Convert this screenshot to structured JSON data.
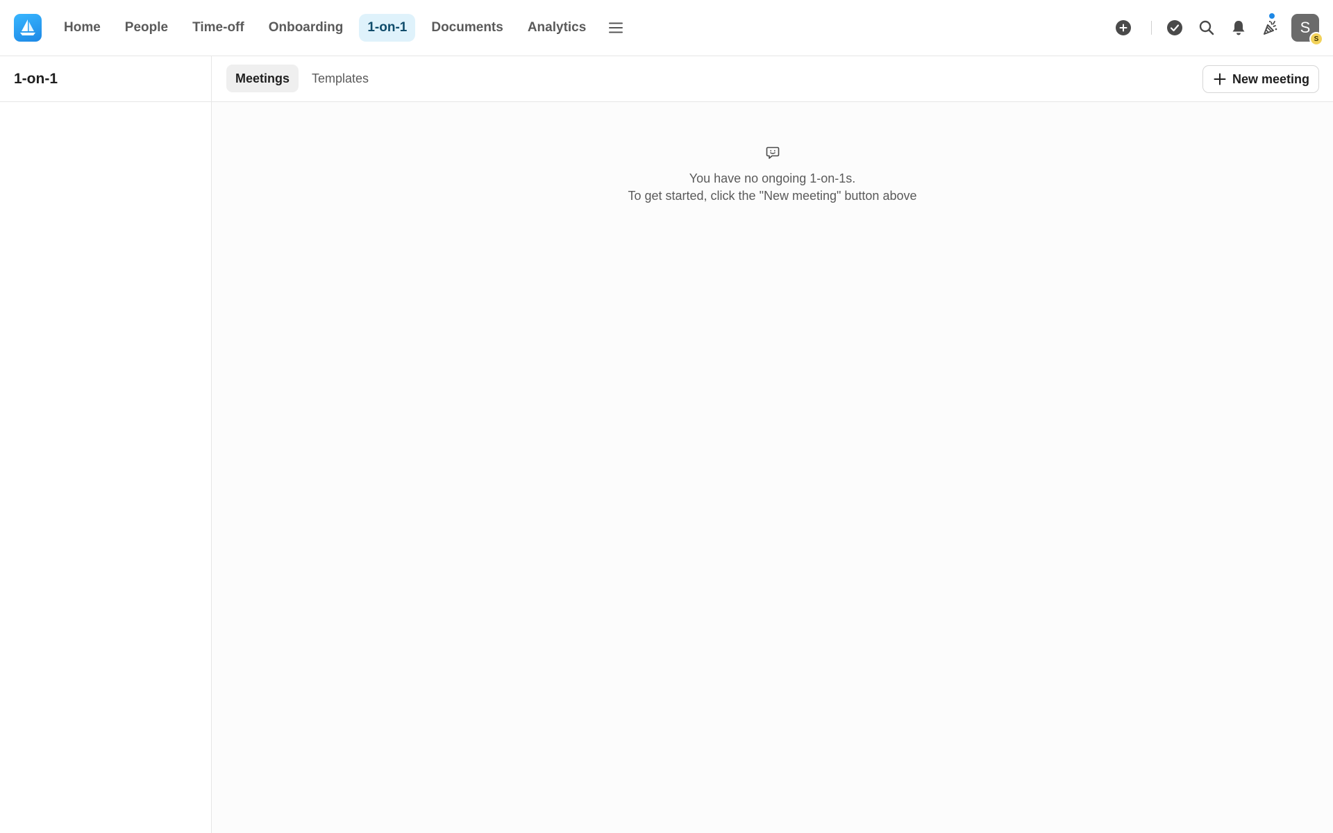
{
  "nav": {
    "items": [
      {
        "label": "Home",
        "active": false
      },
      {
        "label": "People",
        "active": false
      },
      {
        "label": "Time-off",
        "active": false
      },
      {
        "label": "Onboarding",
        "active": false
      },
      {
        "label": "1-on-1",
        "active": true
      },
      {
        "label": "Documents",
        "active": false
      },
      {
        "label": "Analytics",
        "active": false
      }
    ],
    "menu_icon": "hamburger-menu-icon"
  },
  "header_actions": {
    "icons": [
      "add-circle-icon",
      "check-circle-icon",
      "search-icon",
      "bell-icon",
      "party-popper-icon"
    ],
    "avatar_initial": "S",
    "avatar_badge": "S"
  },
  "sidebar": {
    "title": "1-on-1"
  },
  "subbar": {
    "tabs": [
      {
        "label": "Meetings",
        "active": true
      },
      {
        "label": "Templates",
        "active": false
      }
    ],
    "new_button_label": "New meeting"
  },
  "empty_state": {
    "icon": "chat-bubble-smile-icon",
    "line1": "You have no ongoing 1-on-1s.",
    "line2": "To get started, click the \"New meeting\" button above"
  },
  "colors": {
    "accent": "#1e88e5",
    "active_nav_bg": "#dff2fb",
    "avatar_bg": "#6b6b6b",
    "badge_bg": "#f2d25a"
  }
}
